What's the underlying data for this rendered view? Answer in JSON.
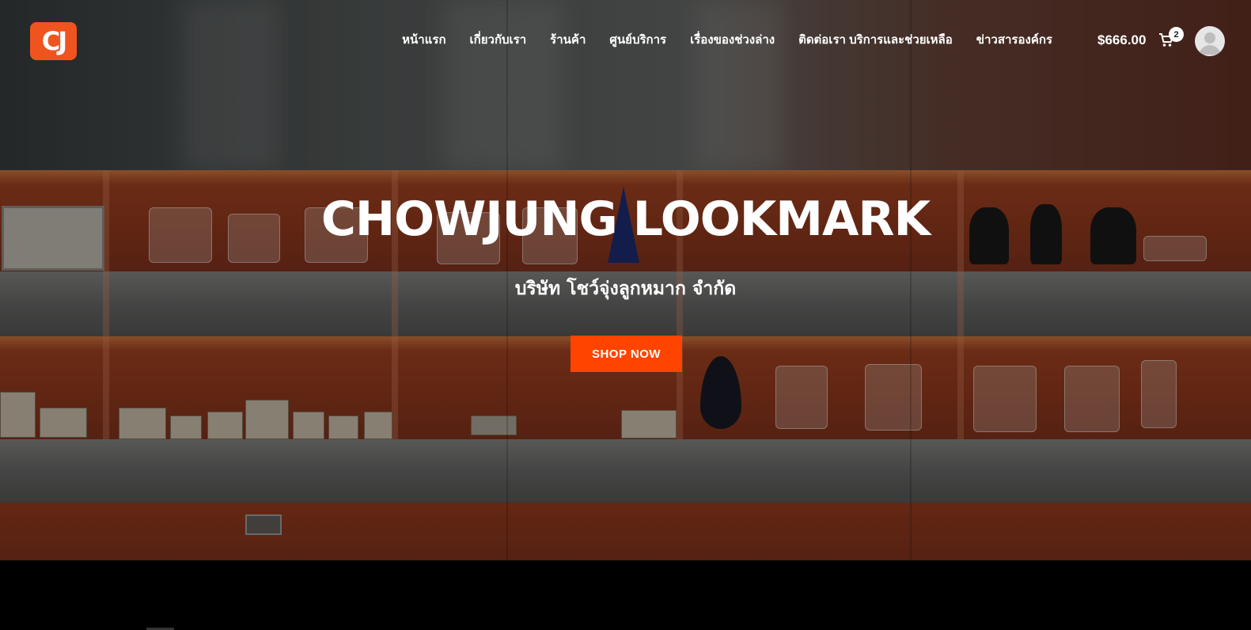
{
  "brand": {
    "logo_text": "CJ",
    "accent": "#ff4400"
  },
  "nav": {
    "items": [
      {
        "label": "หน้าแรก"
      },
      {
        "label": "เกี่ยวกับเรา"
      },
      {
        "label": "ร้านค้า"
      },
      {
        "label": "ศูนย์บริการ"
      },
      {
        "label": "เรื่องของช่วงล่าง"
      },
      {
        "label": "ติดต่อเรา บริการและช่วยเหลือ"
      },
      {
        "label": "ข่าวสารองค์กร"
      }
    ]
  },
  "cart": {
    "total": "$666.00",
    "count": "2",
    "icon": "cart-icon"
  },
  "account": {
    "icon": "user-avatar-icon"
  },
  "hero": {
    "title": "CHOWJUNG LOOKMARK",
    "subtitle": "บริษัท โชว์จุ่งลูกหมาก จำกัด",
    "cta_label": "SHOP NOW"
  }
}
